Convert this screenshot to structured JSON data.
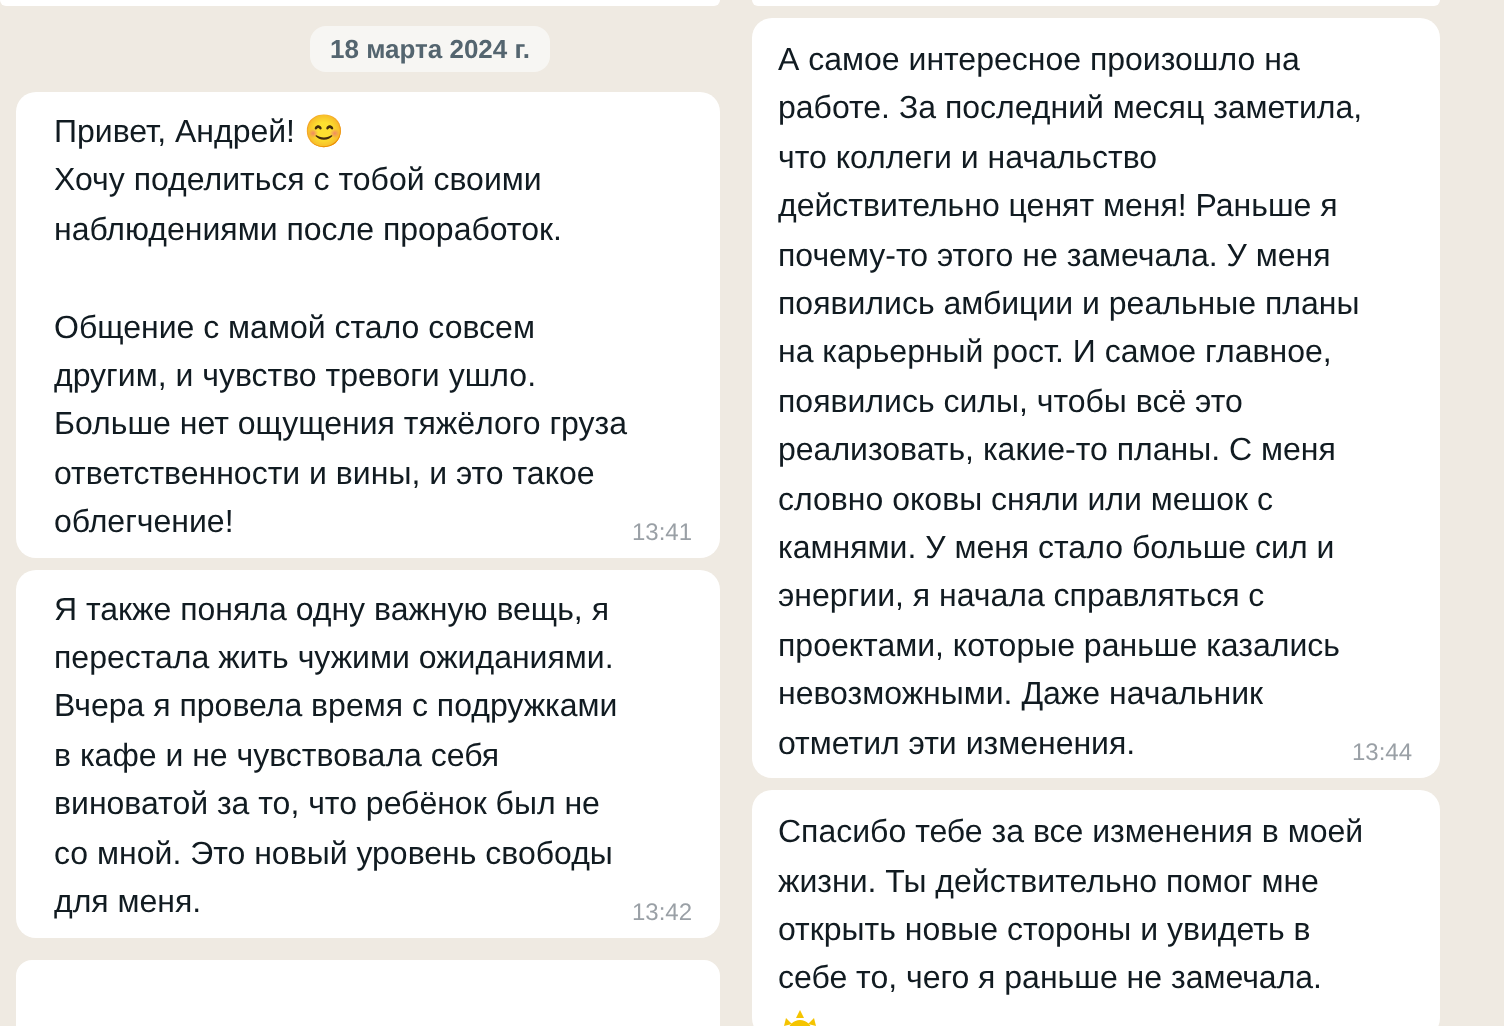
{
  "columns": [
    {
      "date_chip": "18 марта 2024 г.",
      "messages": [
        {
          "kind": "cut_top"
        },
        {
          "kind": "message",
          "text": "Привет, Андрей! 😊\nХочу поделиться с тобой своими\nнаблюдениями после проработок.\n\nОбщение с мамой стало совсем\nдругим, и чувство тревоги ушло.\nБольше нет ощущения тяжёлого груза\nответственности и вины, и это такое\nоблегчение!",
          "time": "13:41"
        },
        {
          "kind": "message",
          "text": "Я также поняла одну важную вещь, я\nперестала жить чужими ожиданиями.\nВчера я провела время с подружками\nв кафе и не чувствовала себя\nвиноватой за то, что ребёнок был не\nсо мной. Это новый уровень свободы\nдля меня.",
          "time": "13:42"
        },
        {
          "kind": "cut_bottom"
        }
      ]
    },
    {
      "messages": [
        {
          "kind": "cut_top"
        },
        {
          "kind": "message",
          "text": "А самое интересное произошло на\nработе. За последний месяц заметила,\nчто коллеги и начальство\nдействительно ценят меня! Раньше я\nпочему-то этого не замечала. У меня\nпоявились амбиции и реальные планы\nна карьерный рост. И самое главное,\nпоявились силы, чтобы всё это\nреализовать, какие-то планы. С меня\nсловно оковы сняли или мешок с\nкамнями. У меня стало больше сил и\nэнергии, я начала справляться с\nпроектами, которые раньше казались\nневозможными. Даже начальник\nотметил эти изменения.",
          "time": "13:44"
        },
        {
          "kind": "message",
          "text": "Спасибо тебе за все изменения в моей\nжизни. Ты действительно помог мне\nоткрыть новые стороны и увидеть в\nсебе то, чего я раньше не замечала.",
          "trailing_emoji": true
        }
      ]
    }
  ]
}
